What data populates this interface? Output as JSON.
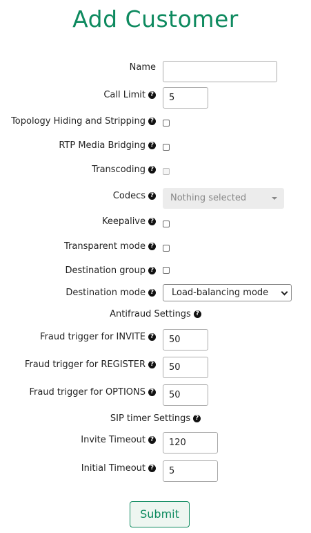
{
  "title": "Add Customer",
  "fields": {
    "name": {
      "label": "Name",
      "value": ""
    },
    "call_limit": {
      "label": "Call Limit",
      "value": "5"
    },
    "topology": {
      "label": "Topology Hiding and Stripping"
    },
    "rtp": {
      "label": "RTP Media Bridging"
    },
    "transcoding": {
      "label": "Transcoding"
    },
    "codecs": {
      "label": "Codecs",
      "placeholder": "Nothing selected"
    },
    "keepalive": {
      "label": "Keepalive"
    },
    "transparent": {
      "label": "Transparent mode"
    },
    "dest_group": {
      "label": "Destination group"
    },
    "dest_mode": {
      "label": "Destination mode",
      "value": "Load-balancing mode"
    }
  },
  "antifraud": {
    "heading": "Antifraud Settings",
    "invite": {
      "label": "Fraud trigger for INVITE",
      "value": "50"
    },
    "register": {
      "label": "Fraud trigger for REGISTER",
      "value": "50"
    },
    "options": {
      "label": "Fraud trigger for OPTIONS",
      "value": "50"
    }
  },
  "sip_timer": {
    "heading": "SIP timer Settings",
    "invite_timeout": {
      "label": "Invite Timeout",
      "value": "120"
    },
    "initial_timeout": {
      "label": "Initial Timeout",
      "value": "5"
    }
  },
  "submit_label": "Submit",
  "icons": {
    "help": "question-circle-icon"
  },
  "colors": {
    "accent": "#0e8a5f"
  }
}
